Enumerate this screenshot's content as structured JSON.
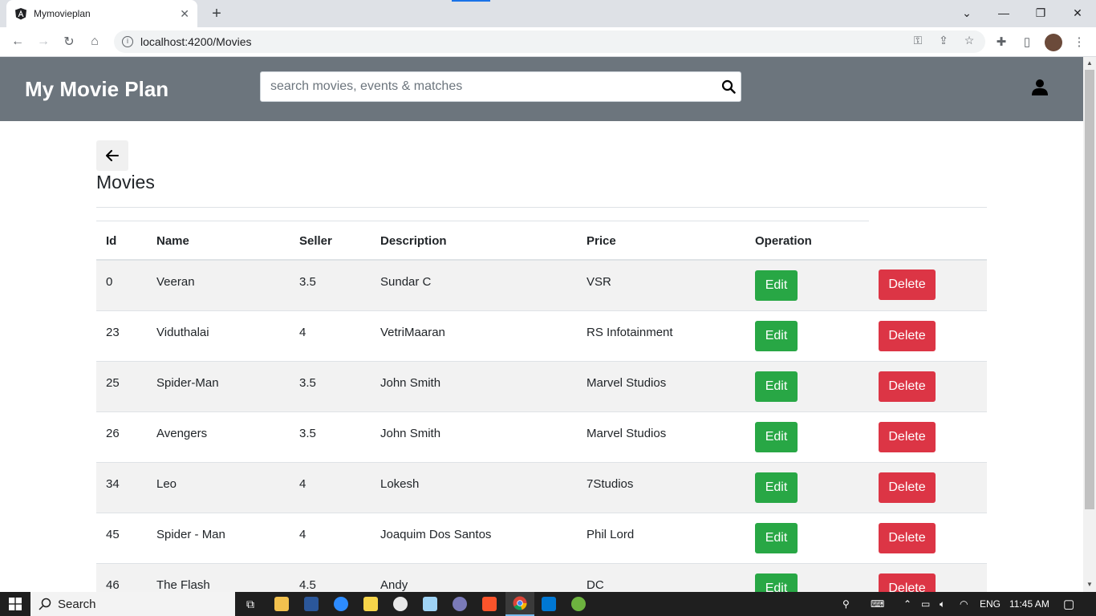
{
  "browser": {
    "tab_title": "Mymovieplan",
    "url": "localhost:4200/Movies"
  },
  "app": {
    "brand": "My Movie Plan",
    "search_placeholder": "search movies, events & matches"
  },
  "page": {
    "title": "Movies"
  },
  "table": {
    "headers": {
      "id": "Id",
      "name": "Name",
      "seller": "Seller",
      "description": "Description",
      "price": "Price",
      "operation": "Operation"
    },
    "edit_label": "Edit",
    "delete_label": "Delete",
    "rows": [
      {
        "id": "0",
        "name": "Veeran",
        "seller": "3.5",
        "description": "Sundar C",
        "price": "VSR"
      },
      {
        "id": "23",
        "name": "Viduthalai",
        "seller": "4",
        "description": "VetriMaaran",
        "price": "RS Infotainment"
      },
      {
        "id": "25",
        "name": "Spider-Man",
        "seller": "3.5",
        "description": "John Smith",
        "price": "Marvel Studios"
      },
      {
        "id": "26",
        "name": "Avengers",
        "seller": "3.5",
        "description": "John Smith",
        "price": "Marvel Studios"
      },
      {
        "id": "34",
        "name": "Leo",
        "seller": "4",
        "description": "Lokesh",
        "price": "7Studios"
      },
      {
        "id": "45",
        "name": "Spider - Man",
        "seller": "4",
        "description": "Joaquim Dos Santos",
        "price": "Phil Lord"
      },
      {
        "id": "46",
        "name": "The Flash",
        "seller": "4.5",
        "description": "Andy",
        "price": "DC"
      }
    ]
  },
  "taskbar": {
    "search_label": "Search",
    "language": "ENG",
    "time": "11:45 AM"
  },
  "colors": {
    "header_bg": "#6c757d",
    "edit": "#28a745",
    "delete": "#dc3545"
  }
}
